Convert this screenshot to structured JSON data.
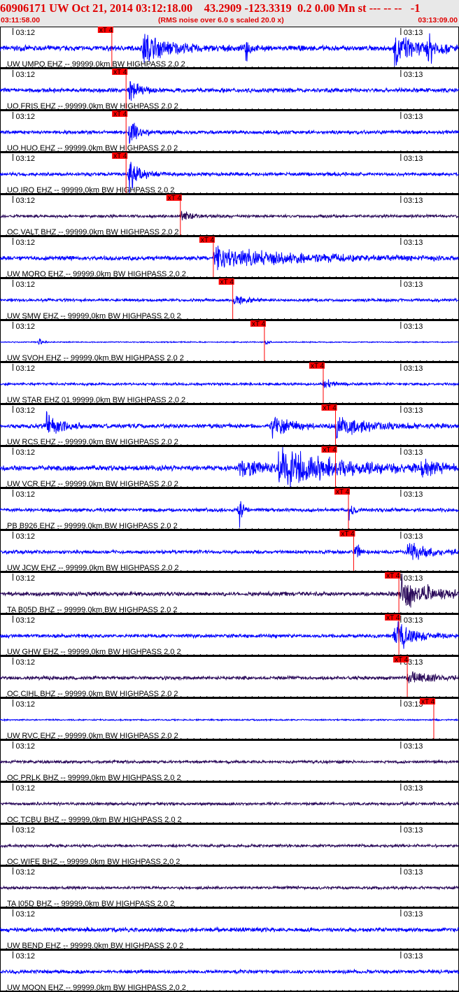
{
  "header": {
    "title": "60906171 UW Oct 21, 2014 03:12:18.00    43.2909 -123.3319  0.2 0.00 Mn st --- -- --   -1",
    "start_time": "03:11:58.00",
    "subtitle": "(RMS noise over 6.0 s scaled 20.0 x)",
    "end_time": "03:13:09.00"
  },
  "chart_data": {
    "type": "line",
    "title": "",
    "x_range": [
      "03:11:58.00",
      "03:13:09.00"
    ],
    "tick_labels": [
      "03:12",
      "03:13"
    ],
    "pick_label": "xT 4",
    "colors": {
      "ehz": "#0000ff",
      "bhz": "#2a0a5a",
      "pick": "#ff0000",
      "pick_box": "#ff0000"
    },
    "traces": [
      {
        "label": "UW UMPQ EHZ -- 99999.0km BW  HIGHPASS  2.0  2",
        "comp": "ehz",
        "pick": "03:12:15.3",
        "noise": 0.15,
        "events": [
          [
            "03:12:20",
            0.9,
            8
          ],
          [
            "03:12:36",
            1,
            1
          ],
          [
            "03:12:59",
            0.9,
            6
          ],
          [
            "03:13:04",
            1,
            3
          ]
        ]
      },
      {
        "label": "UO FRIS EHZ -- 99999.0km BW  HIGHPASS  2.0  2",
        "comp": "ehz",
        "pick": "03:12:17.5",
        "noise": 0.12,
        "events": [
          [
            "03:12:18",
            0.6,
            3
          ]
        ]
      },
      {
        "label": "UO HUO EHZ -- 99999.0km BW  HIGHPASS  2.0  2",
        "comp": "ehz",
        "pick": "03:12:17.5",
        "noise": 0.1,
        "events": [
          [
            "03:12:18",
            0.9,
            3
          ]
        ]
      },
      {
        "label": "UO IRO EHZ -- 99999.0km BW  HIGHPASS  2.0  2",
        "comp": "ehz",
        "pick": "03:12:17.5",
        "noise": 0.1,
        "events": [
          [
            "03:12:18",
            1,
            3
          ]
        ]
      },
      {
        "label": "OC VALT BHZ -- 99999.0km BW  HIGHPASS  2.0  2",
        "comp": "bhz",
        "pick": "03:12:25.9",
        "noise": 0.08,
        "events": [
          [
            "03:12:26",
            0.3,
            3
          ]
        ]
      },
      {
        "label": "UW MORO EHZ -- 99999.0km BW  HIGHPASS  2.0  2",
        "comp": "ehz",
        "pick": "03:12:31.0",
        "noise": 0.12,
        "events": [
          [
            "03:12:31",
            0.55,
            25
          ]
        ]
      },
      {
        "label": "UW SMW EHZ -- 99999.0km BW  HIGHPASS  2.0  2",
        "comp": "ehz",
        "pick": "03:12:34.0",
        "noise": 0.08,
        "events": [
          [
            "03:12:34",
            0.3,
            4
          ]
        ]
      },
      {
        "label": "UW SVOH EHZ -- 99999.0km BW  HIGHPASS  2.0  2",
        "comp": "ehz",
        "pick": "03:12:38.9",
        "noise": 0.03,
        "events": [
          [
            "03:12:04",
            0.25,
            1
          ],
          [
            "03:12:39",
            0.2,
            1
          ]
        ]
      },
      {
        "label": "UW STAR EHZ 01 99999.0km BW  HIGHPASS  2.0  2",
        "comp": "ehz",
        "pick": "03:12:48.0",
        "noise": 0.07,
        "events": [
          [
            "03:12:48",
            0.3,
            3
          ]
        ]
      },
      {
        "label": "UW RCS EHZ -- 99999.0km BW  HIGHPASS  2.0  2",
        "comp": "ehz",
        "pick": "03:12:49.9",
        "noise": 0.12,
        "events": [
          [
            "03:12:05",
            1,
            4
          ],
          [
            "03:12:40",
            0.6,
            6
          ],
          [
            "03:12:50",
            0.5,
            12
          ]
        ]
      },
      {
        "label": "UW VCR EHZ -- 99999.0km BW  HIGHPASS  2.0  2",
        "comp": "ehz",
        "pick": "03:12:49.9",
        "noise": 0.15,
        "events": [
          [
            "03:12:35",
            0.5,
            8
          ],
          [
            "03:12:41",
            1,
            20
          ],
          [
            "03:13:03",
            0.4,
            6
          ]
        ]
      },
      {
        "label": "PB B926 EHZ -- 99999.0km BW  HIGHPASS  2.0  2",
        "comp": "ehz",
        "pick": "03:12:51.9",
        "noise": 0.1,
        "events": [
          [
            "03:12:35",
            1,
            1
          ],
          [
            "03:12:52",
            1,
            1
          ]
        ]
      },
      {
        "label": "UW JCW EHZ -- 99999.0km BW  HIGHPASS  2.0  2",
        "comp": "ehz",
        "pick": "03:12:52.7",
        "noise": 0.1,
        "events": [
          [
            "03:12:53",
            1,
            1
          ],
          [
            "03:13:01",
            0.5,
            8
          ]
        ]
      },
      {
        "label": "TA B05D BHZ -- 99999.0km BW  HIGHPASS  2.0  2",
        "comp": "bhz",
        "pick": "03:12:59.7",
        "noise": 0.12,
        "events": [
          [
            "03:13:00",
            1,
            9
          ]
        ]
      },
      {
        "label": "UW GHW EHZ -- 99999.0km BW  HIGHPASS  2.0  2",
        "comp": "ehz",
        "pick": "03:12:59.7",
        "noise": 0.1,
        "events": [
          [
            "03:12:59",
            1,
            5
          ]
        ]
      },
      {
        "label": "OC CIHL BHZ -- 99999.0km BW  HIGHPASS  2.0  2",
        "comp": "bhz",
        "pick": "03:13:01.0",
        "noise": 0.1,
        "events": [
          [
            "03:13:01",
            0.4,
            7
          ]
        ]
      },
      {
        "label": "UW RVC EHZ -- 99999.0km BW  HIGHPASS  2.0  2",
        "comp": "ehz",
        "pick": "03:13:05.1",
        "noise": 0.04,
        "events": []
      },
      {
        "label": "OC PRLK BHZ -- 99999.0km BW  HIGHPASS  2.0  2",
        "comp": "bhz",
        "pick": null,
        "noise": 0.08,
        "events": []
      },
      {
        "label": "OC TCBU BHZ -- 99999.0km BW  HIGHPASS  2.0  2",
        "comp": "bhz",
        "pick": null,
        "noise": 0.08,
        "events": []
      },
      {
        "label": "OC WIFE BHZ -- 99999.0km BW  HIGHPASS  2.0  2",
        "comp": "bhz",
        "pick": null,
        "noise": 0.08,
        "events": []
      },
      {
        "label": "TA I05D BHZ -- 99999.0km BW  HIGHPASS  2.0  2",
        "comp": "bhz",
        "pick": null,
        "noise": 0.08,
        "events": []
      },
      {
        "label": "UW BEND EHZ -- 99999.0km BW  HIGHPASS  2.0  2",
        "comp": "ehz",
        "pick": null,
        "noise": 0.12,
        "events": []
      },
      {
        "label": "UW MOON EHZ -- 99999.0km BW  HIGHPASS  2.0  2",
        "comp": "ehz",
        "pick": null,
        "noise": 0.1,
        "events": []
      }
    ]
  }
}
